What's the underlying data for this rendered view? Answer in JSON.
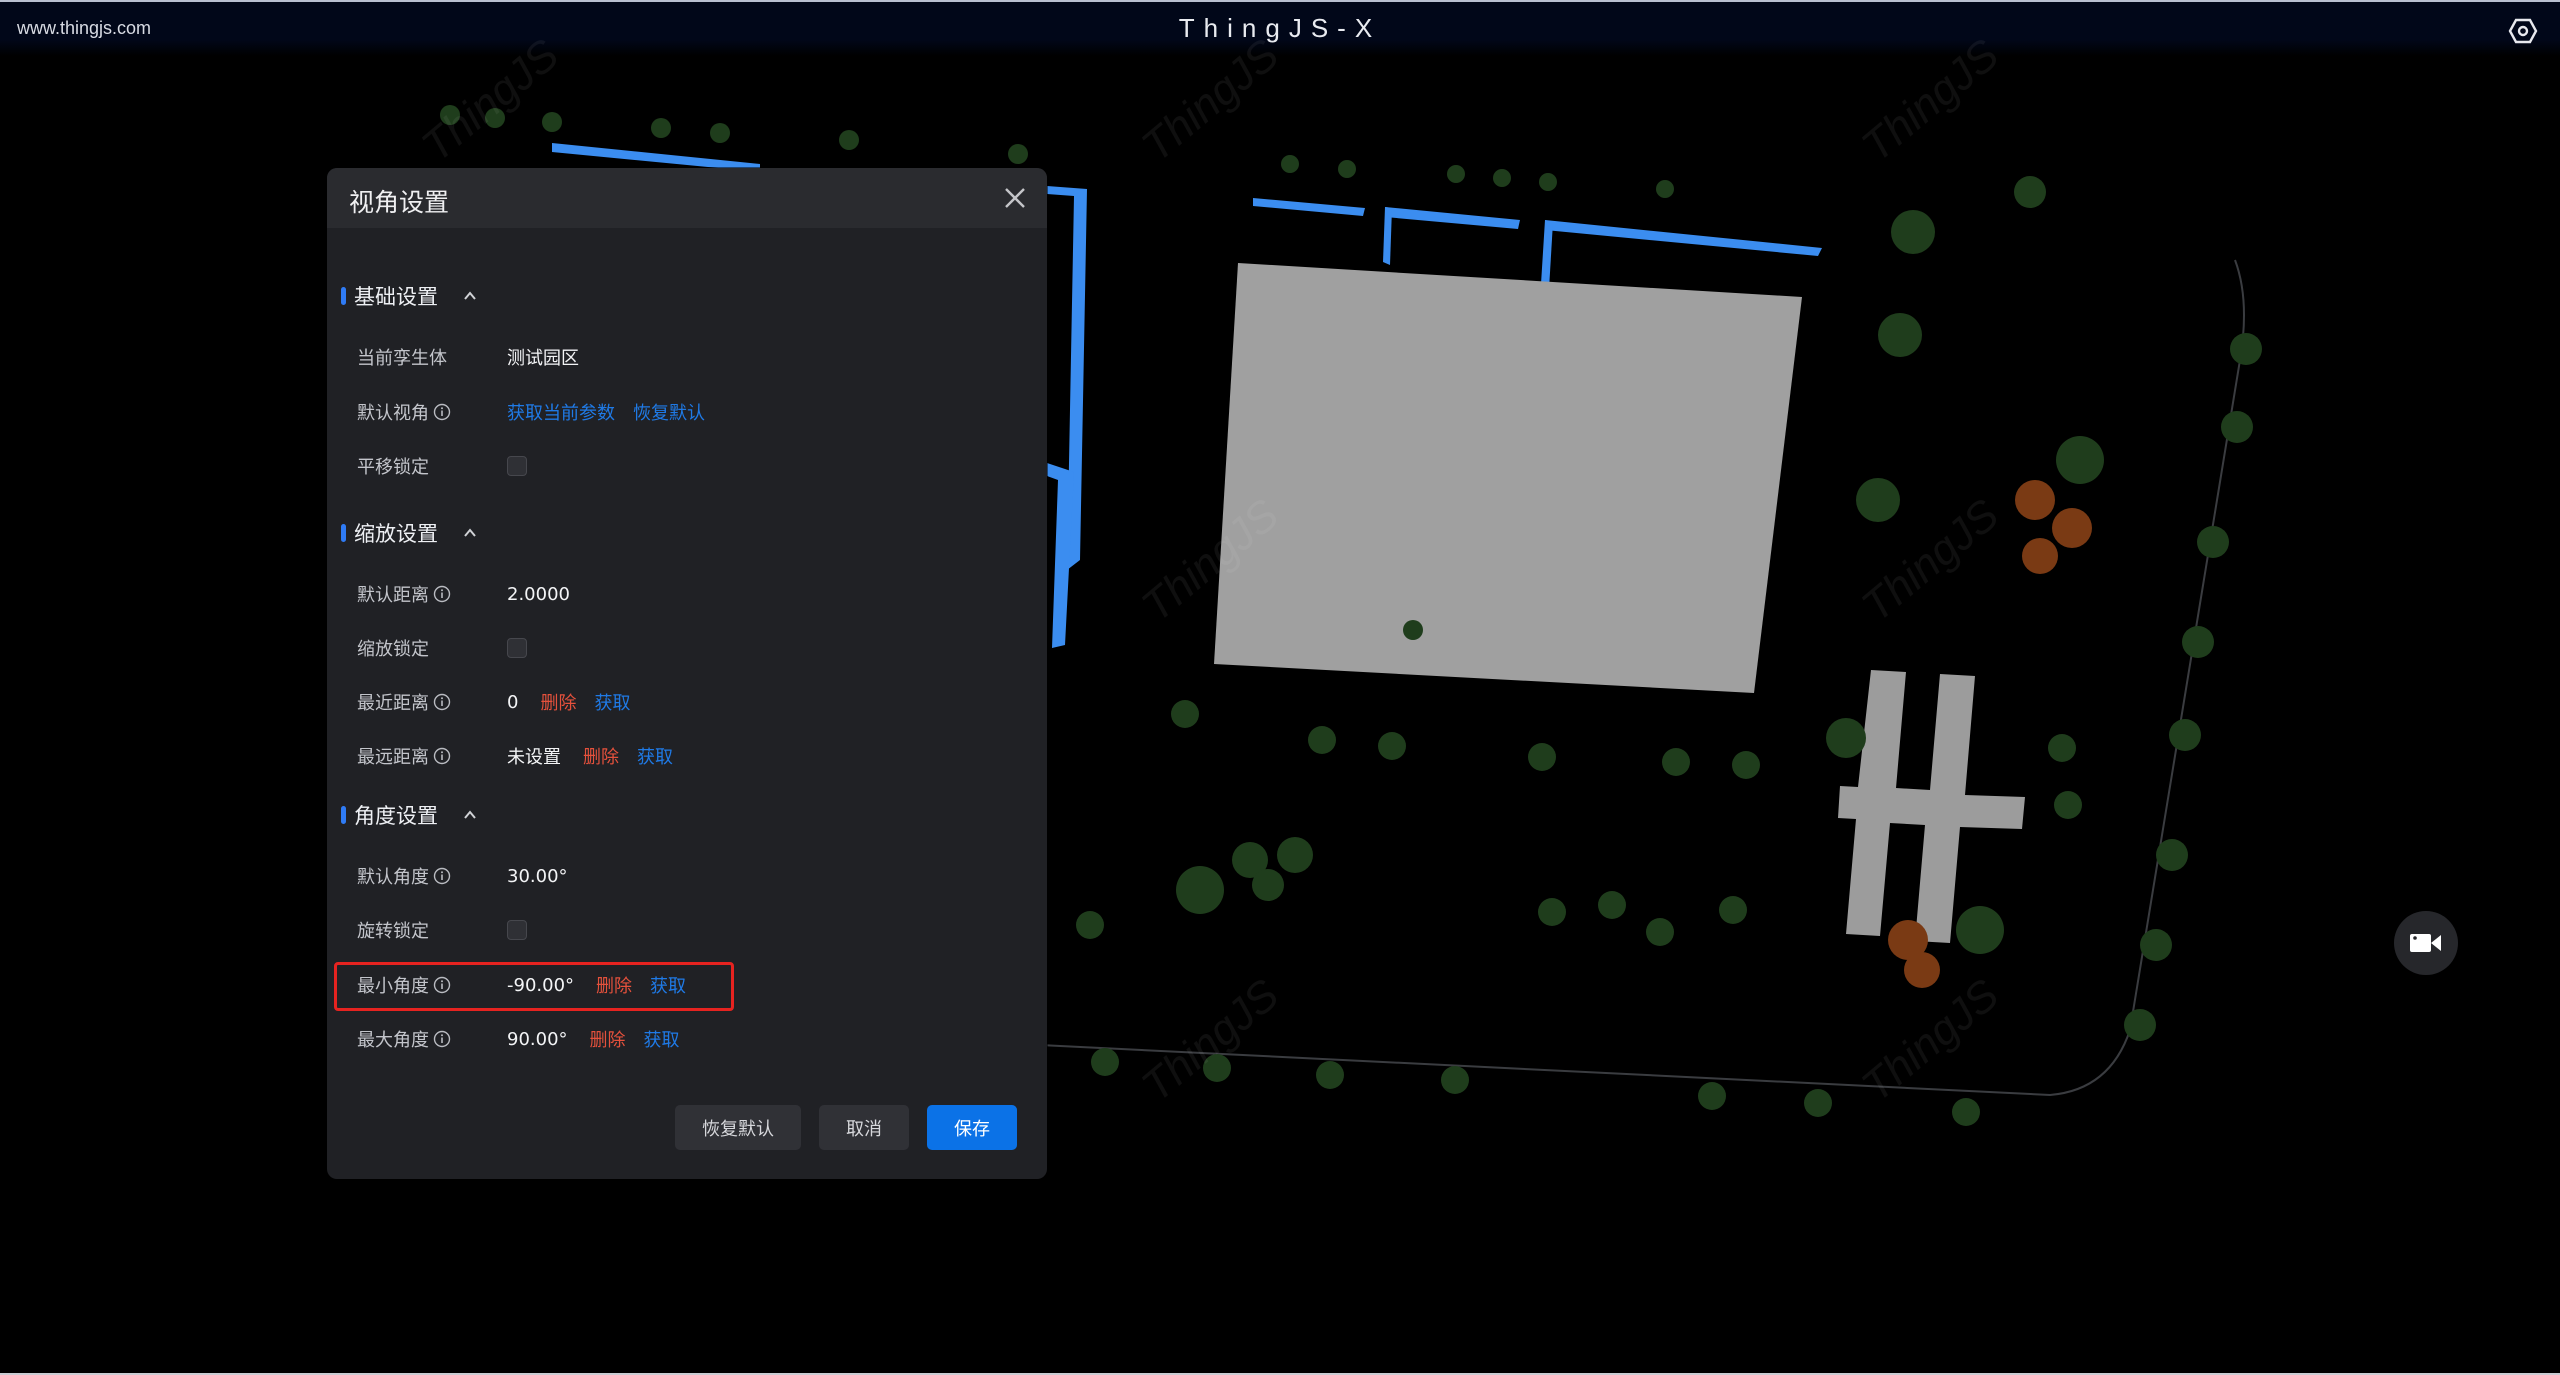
{
  "topbar": {
    "site_url": "www.thingjs.com",
    "app_title": "ThingJS-X",
    "settings_icon": "hexagon-gear-icon"
  },
  "scene": {
    "watermark_text": "ThingJS",
    "camera_button_icon": "video-camera-icon"
  },
  "dialog": {
    "title": "视角设置",
    "close_icon": "close-icon",
    "sections": {
      "basic": {
        "title": "基础设置",
        "rows": {
          "twin": {
            "label": "当前孪生体",
            "value": "测试园区"
          },
          "default_view": {
            "label": "默认视角",
            "action_get": "获取当前参数",
            "action_restore": "恢复默认"
          },
          "pan_lock": {
            "label": "平移锁定",
            "checked": false
          }
        }
      },
      "zoom": {
        "title": "缩放设置",
        "rows": {
          "default_distance": {
            "label": "默认距离",
            "value": "2.0000"
          },
          "zoom_lock": {
            "label": "缩放锁定",
            "checked": false
          },
          "min_distance": {
            "label": "最近距离",
            "value": "0",
            "delete": "删除",
            "get": "获取"
          },
          "max_distance": {
            "label": "最远距离",
            "value": "未设置",
            "delete": "删除",
            "get": "获取"
          }
        }
      },
      "angle": {
        "title": "角度设置",
        "rows": {
          "default_angle": {
            "label": "默认角度",
            "value": "30.00°"
          },
          "rotate_lock": {
            "label": "旋转锁定",
            "checked": false
          },
          "min_angle": {
            "label": "最小角度",
            "value": "-90.00°",
            "delete": "删除",
            "get": "获取"
          },
          "max_angle": {
            "label": "最大角度",
            "value": "90.00°",
            "delete": "删除",
            "get": "获取"
          }
        }
      }
    },
    "buttons": {
      "restore_default": "恢复默认",
      "cancel": "取消",
      "save": "保存"
    }
  },
  "colors": {
    "accent_blue": "#0b72e7",
    "link_blue": "#1f7ae6",
    "delete_red": "#e5513c",
    "highlight_red": "#e62320"
  }
}
